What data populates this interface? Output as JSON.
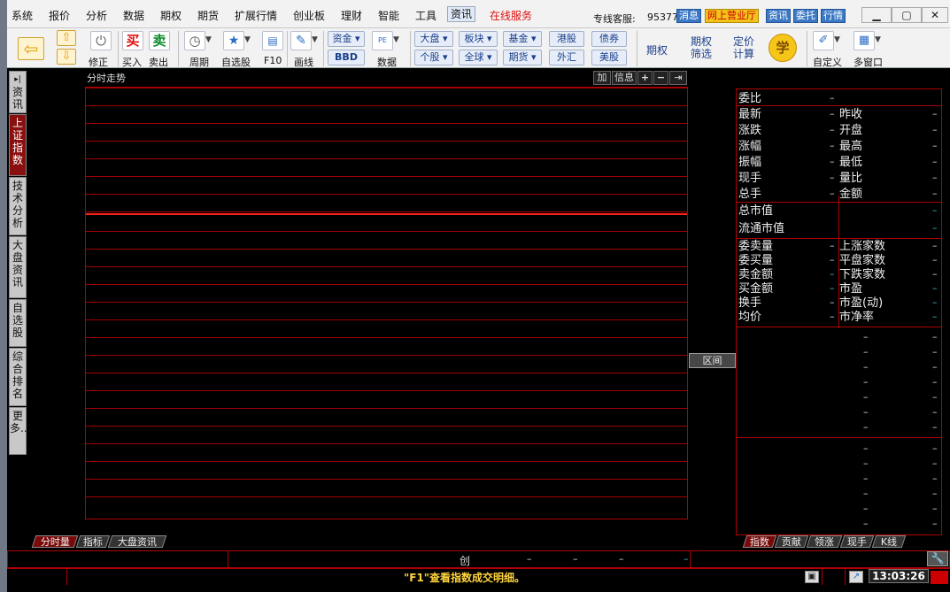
{
  "menubar": {
    "items": [
      "系统",
      "报价",
      "分析",
      "数据",
      "期权",
      "期货",
      "扩展行情",
      "创业板",
      "理财",
      "智能",
      "工具",
      "资讯",
      "在线服务"
    ],
    "hotline_label": "专线客服:",
    "hotline_number": "95377",
    "buttons": [
      "消息",
      "网上营业厅",
      "资讯",
      "委托",
      "行情"
    ]
  },
  "toolbar": {
    "correct": "修正",
    "buy_icon": "买",
    "buy": "买入",
    "sell_icon": "卖",
    "sell": "卖出",
    "period": "周期",
    "watchlist": "自选股",
    "f10": "F10",
    "draw": "画线",
    "fund": "资金",
    "bbd": "BBD",
    "pe": "PE",
    "data": "数据",
    "market": "大盘",
    "stock": "个股",
    "sector": "板块",
    "global": "全球",
    "fundx": "基金",
    "futures": "期货",
    "hk": "港股",
    "fx": "外汇",
    "bond": "债券",
    "us": "美股",
    "option": "期权",
    "option_screen": "期权筛选",
    "pricing": "定价计算",
    "learn": "学",
    "custom": "自定义",
    "multiwin": "多窗口"
  },
  "left_tabs": [
    "资讯",
    "上证指数",
    "技术分析",
    "大盘资讯",
    "自选股",
    "综合排名",
    "更多..."
  ],
  "chart": {
    "title": "分时走势",
    "buttons": [
      "加",
      "信息"
    ],
    "range_button": "区间"
  },
  "quote": {
    "rows1": [
      {
        "label": "委比",
        "value": "–"
      },
      {
        "label": "最新",
        "value": "–",
        "label2": "昨收",
        "value2": "–"
      },
      {
        "label": "涨跌",
        "value": "–",
        "label2": "开盘",
        "value2": "–"
      },
      {
        "label": "涨幅",
        "value": "–",
        "label2": "最高",
        "value2": "–"
      },
      {
        "label": "振幅",
        "value": "–",
        "label2": "最低",
        "value2": "–"
      },
      {
        "label": "现手",
        "value": "–",
        "label2": "量比",
        "value2": "–"
      },
      {
        "label": "总手",
        "value": "–",
        "label2": "金额",
        "value2": "–"
      }
    ],
    "rows2": [
      {
        "label": "总市值",
        "value": "–"
      },
      {
        "label": "流通市值",
        "value": "–"
      }
    ],
    "rows3": [
      {
        "label": "委卖量",
        "value": "–",
        "label2": "上涨家数",
        "value2": "–"
      },
      {
        "label": "委买量",
        "value": "–",
        "label2": "平盘家数",
        "value2": "–"
      },
      {
        "label": "卖金额",
        "value": "–",
        "label2": "下跌家数",
        "value2": "–"
      },
      {
        "label": "买金额",
        "value": "–",
        "label2": "市盈",
        "value2": "–"
      },
      {
        "label": "换手",
        "value": "–",
        "label2": "市盈(动)",
        "value2": "–"
      },
      {
        "label": "均价",
        "value": "–",
        "label2": "市净率",
        "value2": "–"
      }
    ],
    "dash": "–"
  },
  "bottom_tabs": [
    "分时量",
    "指标",
    "大盘资讯"
  ],
  "right_tabs": [
    "指数",
    "贡献",
    "领涨",
    "现手",
    "K线"
  ],
  "ticker": {
    "name": "创",
    "v1": "–",
    "v2": "–",
    "v3": "–",
    "v4": "–"
  },
  "status": {
    "message": "\"F1\"查看指数成交明细。",
    "time": "13:03:26"
  },
  "colors": {
    "grid": "#a00000",
    "status_text": "#ffd33d",
    "value_cyan": "#38c0c8"
  }
}
